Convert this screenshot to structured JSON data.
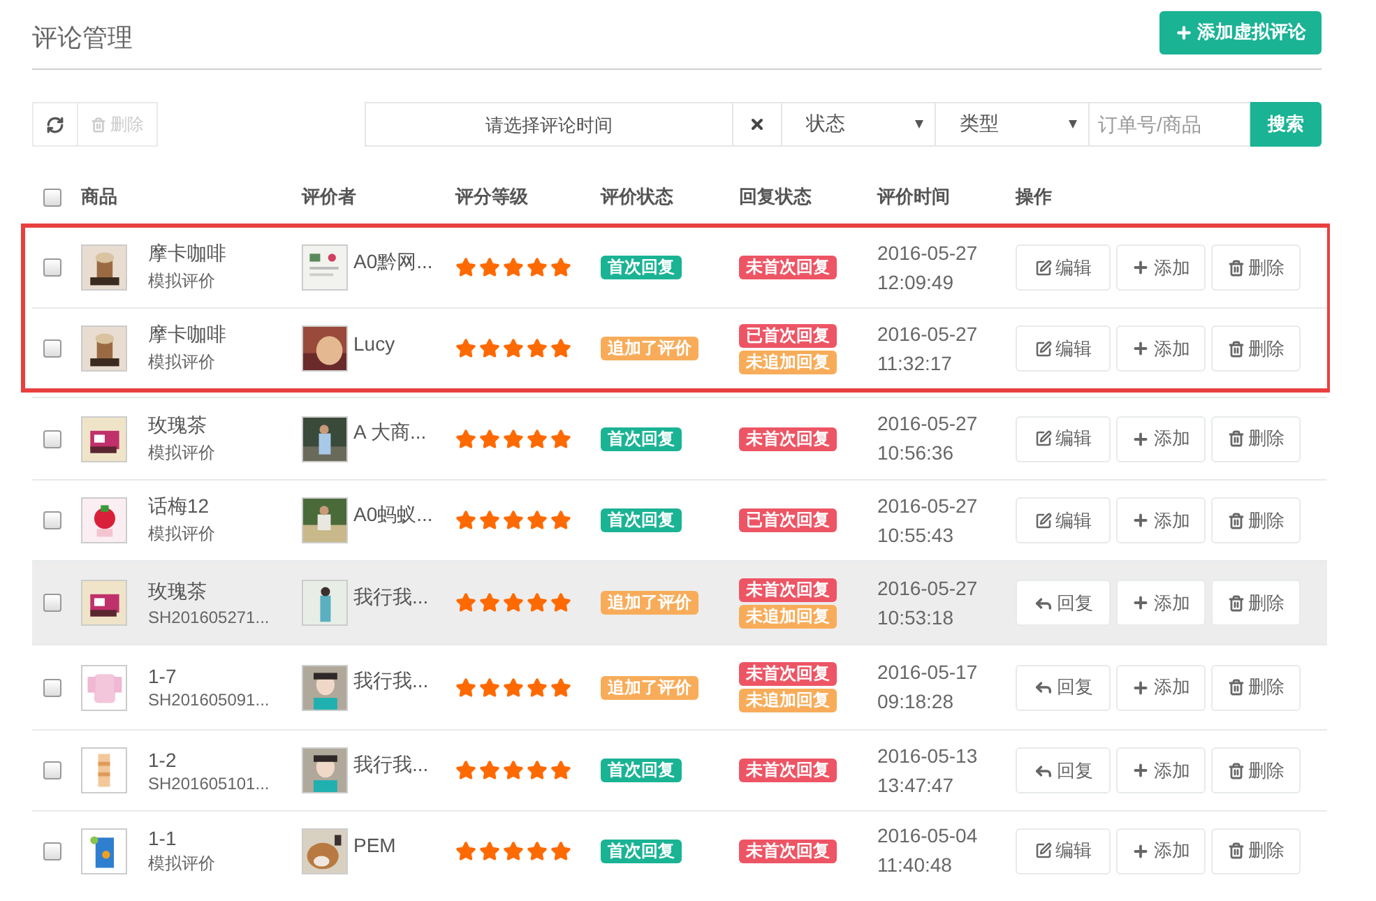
{
  "page": {
    "title": "评论管理",
    "add_button": "添加虚拟评论"
  },
  "toolbar": {
    "delete_button": {
      "label": "删除",
      "disabled": true
    },
    "date_field": {
      "placeholder": "请选择评论时间"
    },
    "status_select": {
      "value": "状态"
    },
    "type_select": {
      "value": "类型"
    },
    "search_field": {
      "placeholder": "订单号/商品"
    },
    "search_button": "搜索"
  },
  "table": {
    "header_checked": false,
    "columns": [
      "商品",
      "评价者",
      "评分等级",
      "评价状态",
      "回复状态",
      "评价时间",
      "操作"
    ],
    "rows": [
      {
        "checked": false,
        "framed": true,
        "highlighted": false,
        "product": "摩卡咖啡",
        "source": "模拟评价",
        "reviewer": "A0黔网...",
        "stars": 5,
        "review_badges": [
          {
            "label": "首次回复",
            "color": "#1ab394"
          }
        ],
        "reply_badges": [
          {
            "label": "未首次回复",
            "color": "#ed5565"
          }
        ],
        "date": "2016-05-27",
        "time": "12:09:49",
        "actions": [
          {
            "kind": "edit",
            "label": "编辑"
          },
          {
            "kind": "add",
            "label": "添加"
          },
          {
            "kind": "delete",
            "label": "删除"
          }
        ]
      },
      {
        "checked": false,
        "framed": true,
        "highlighted": false,
        "product": "摩卡咖啡",
        "source": "模拟评价",
        "reviewer": "Lucy",
        "stars": 5,
        "review_badges": [
          {
            "label": "追加了评价",
            "color": "#f8ac59"
          }
        ],
        "reply_badges": [
          {
            "label": "已首次回复",
            "color": "#ed5565"
          },
          {
            "label": "未追加回复",
            "color": "#f8ac59"
          }
        ],
        "date": "2016-05-27",
        "time": "11:32:17",
        "actions": [
          {
            "kind": "edit",
            "label": "编辑"
          },
          {
            "kind": "add",
            "label": "添加"
          },
          {
            "kind": "delete",
            "label": "删除"
          }
        ]
      },
      {
        "checked": false,
        "framed": false,
        "highlighted": false,
        "product": "玫瑰茶",
        "source": "模拟评价",
        "reviewer": "A 大商...",
        "stars": 5,
        "review_badges": [
          {
            "label": "首次回复",
            "color": "#1ab394"
          }
        ],
        "reply_badges": [
          {
            "label": "未首次回复",
            "color": "#ed5565"
          }
        ],
        "date": "2016-05-27",
        "time": "10:56:36",
        "actions": [
          {
            "kind": "edit",
            "label": "编辑"
          },
          {
            "kind": "add",
            "label": "添加"
          },
          {
            "kind": "delete",
            "label": "删除"
          }
        ]
      },
      {
        "checked": false,
        "framed": false,
        "highlighted": false,
        "product": "话梅12",
        "source": "模拟评价",
        "reviewer": "A0蚂蚁...",
        "stars": 5,
        "review_badges": [
          {
            "label": "首次回复",
            "color": "#1ab394"
          }
        ],
        "reply_badges": [
          {
            "label": "已首次回复",
            "color": "#ed5565"
          }
        ],
        "date": "2016-05-27",
        "time": "10:55:43",
        "actions": [
          {
            "kind": "edit",
            "label": "编辑"
          },
          {
            "kind": "add",
            "label": "添加"
          },
          {
            "kind": "delete",
            "label": "删除"
          }
        ]
      },
      {
        "checked": false,
        "framed": false,
        "highlighted": true,
        "product": "玫瑰茶",
        "source": "SH201605271...",
        "reviewer": "我行我...",
        "stars": 5,
        "review_badges": [
          {
            "label": "追加了评价",
            "color": "#f8ac59"
          }
        ],
        "reply_badges": [
          {
            "label": "未首次回复",
            "color": "#ed5565"
          },
          {
            "label": "未追加回复",
            "color": "#f8ac59"
          }
        ],
        "date": "2016-05-27",
        "time": "10:53:18",
        "actions": [
          {
            "kind": "reply",
            "label": "回复"
          },
          {
            "kind": "add",
            "label": "添加"
          },
          {
            "kind": "delete",
            "label": "删除"
          }
        ]
      },
      {
        "checked": false,
        "framed": false,
        "highlighted": false,
        "product": "1-7",
        "source": "SH201605091...",
        "reviewer": "我行我...",
        "stars": 5,
        "review_badges": [
          {
            "label": "追加了评价",
            "color": "#f8ac59"
          }
        ],
        "reply_badges": [
          {
            "label": "未首次回复",
            "color": "#ed5565"
          },
          {
            "label": "未追加回复",
            "color": "#f8ac59"
          }
        ],
        "date": "2016-05-17",
        "time": "09:18:28",
        "actions": [
          {
            "kind": "reply",
            "label": "回复"
          },
          {
            "kind": "add",
            "label": "添加"
          },
          {
            "kind": "delete",
            "label": "删除"
          }
        ]
      },
      {
        "checked": false,
        "framed": false,
        "highlighted": false,
        "product": "1-2",
        "source": "SH201605101...",
        "reviewer": "我行我...",
        "stars": 5,
        "review_badges": [
          {
            "label": "首次回复",
            "color": "#1ab394"
          }
        ],
        "reply_badges": [
          {
            "label": "未首次回复",
            "color": "#ed5565"
          }
        ],
        "date": "2016-05-13",
        "time": "13:47:47",
        "actions": [
          {
            "kind": "reply",
            "label": "回复"
          },
          {
            "kind": "add",
            "label": "添加"
          },
          {
            "kind": "delete",
            "label": "删除"
          }
        ]
      },
      {
        "checked": false,
        "framed": false,
        "highlighted": false,
        "product": "1-1",
        "source": "模拟评价",
        "reviewer": "PEM",
        "stars": 5,
        "review_badges": [
          {
            "label": "首次回复",
            "color": "#1ab394"
          }
        ],
        "reply_badges": [
          {
            "label": "未首次回复",
            "color": "#ed5565"
          }
        ],
        "date": "2016-05-04",
        "time": "11:40:48",
        "actions": [
          {
            "kind": "edit",
            "label": "编辑"
          },
          {
            "kind": "add",
            "label": "添加"
          },
          {
            "kind": "delete",
            "label": "删除"
          }
        ]
      }
    ]
  }
}
